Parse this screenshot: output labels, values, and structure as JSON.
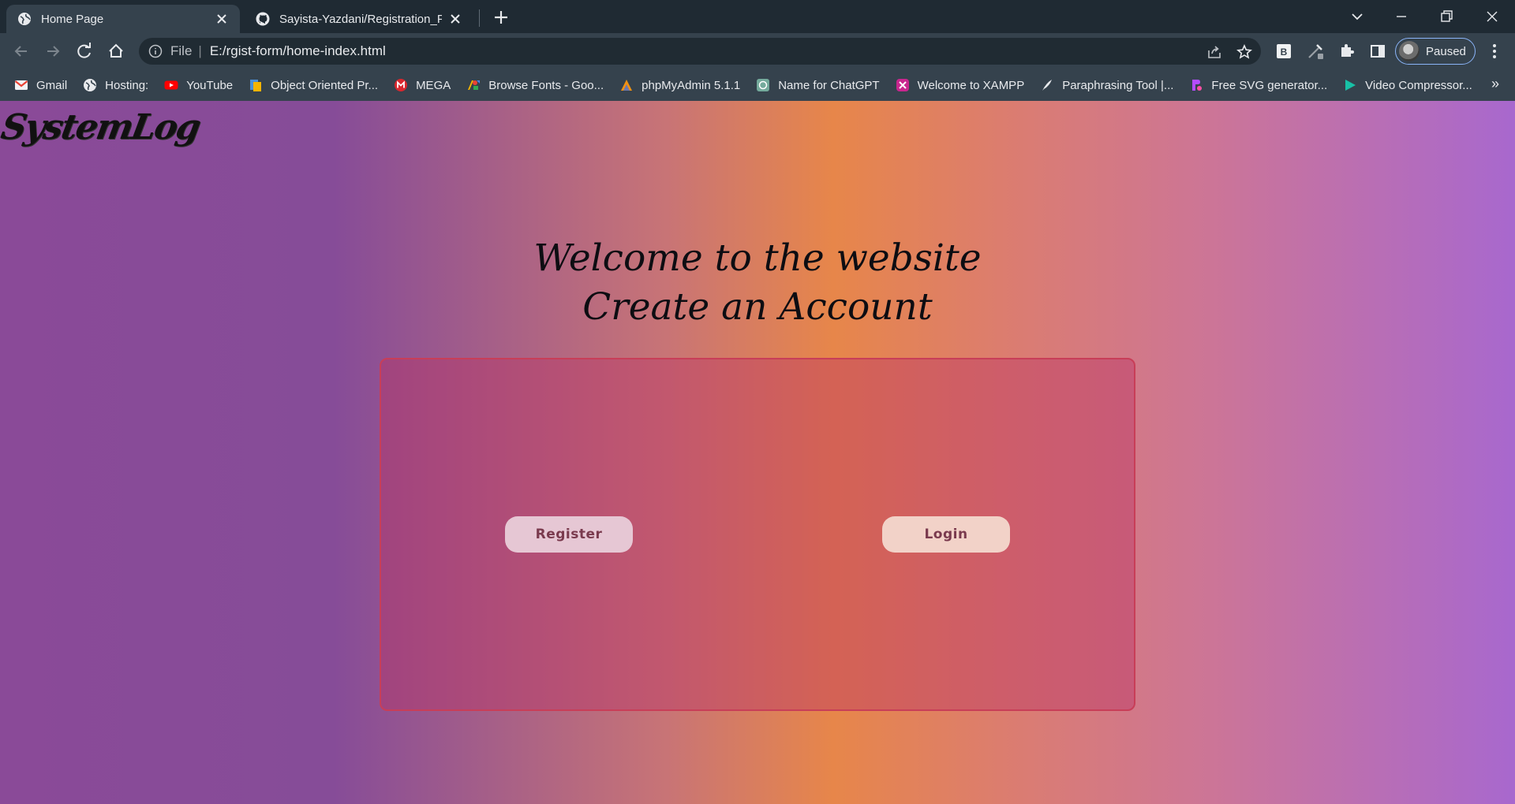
{
  "browser": {
    "tabs": [
      {
        "title": "Home Page",
        "active": true,
        "icon": "globe-icon"
      },
      {
        "title": "Sayista-Yazdani/Registration_Form",
        "active": false,
        "icon": "github-icon"
      }
    ],
    "address_bar": {
      "scheme_label": "File",
      "url": "E:/rgist-form/home-index.html"
    },
    "profile_status": "Paused",
    "bookmarks": [
      {
        "label": "Gmail",
        "icon": "gmail-icon",
        "color": "#ea4335"
      },
      {
        "label": "Hosting:",
        "icon": "globe-icon",
        "color": "#e8eaed"
      },
      {
        "label": "YouTube",
        "icon": "youtube-icon",
        "color": "#ff0000"
      },
      {
        "label": "Object Oriented Pr...",
        "icon": "book-icon",
        "color": "#f4b400"
      },
      {
        "label": "MEGA",
        "icon": "mega-icon",
        "color": "#d9272e"
      },
      {
        "label": "Browse Fonts - Goo...",
        "icon": "google-fonts-icon",
        "color": "#4285f4"
      },
      {
        "label": "phpMyAdmin 5.1.1",
        "icon": "phpmyadmin-icon",
        "color": "#f29111"
      },
      {
        "label": "Name for ChatGPT",
        "icon": "chatgpt-icon",
        "color": "#74aa9c"
      },
      {
        "label": "Welcome to XAMPP",
        "icon": "xampp-icon",
        "color": "#c8268e"
      },
      {
        "label": "Paraphrasing Tool |...",
        "icon": "feather-icon",
        "color": "#e8eaed"
      },
      {
        "label": "Free SVG generator...",
        "icon": "svg-generator-icon",
        "color": "#b44cff"
      },
      {
        "label": "Video Compressor...",
        "icon": "play-icon",
        "color": "#17c1a6"
      }
    ],
    "bookmarks_overflow": "»"
  },
  "page": {
    "logo_text": "SystemLog",
    "headline_line1": "Welcome to the website",
    "headline_line2": "Create an Account",
    "buttons": {
      "register": "Register",
      "login": "Login"
    }
  },
  "colors": {
    "chrome_dark": "#1f2a33",
    "chrome_toolbar": "#35424d",
    "gradient_purple": "#8a4a98",
    "gradient_orange": "#e7864a",
    "gradient_violet": "#a868ce",
    "card_border": "#c83e58",
    "button_text": "#7a3a4e"
  }
}
